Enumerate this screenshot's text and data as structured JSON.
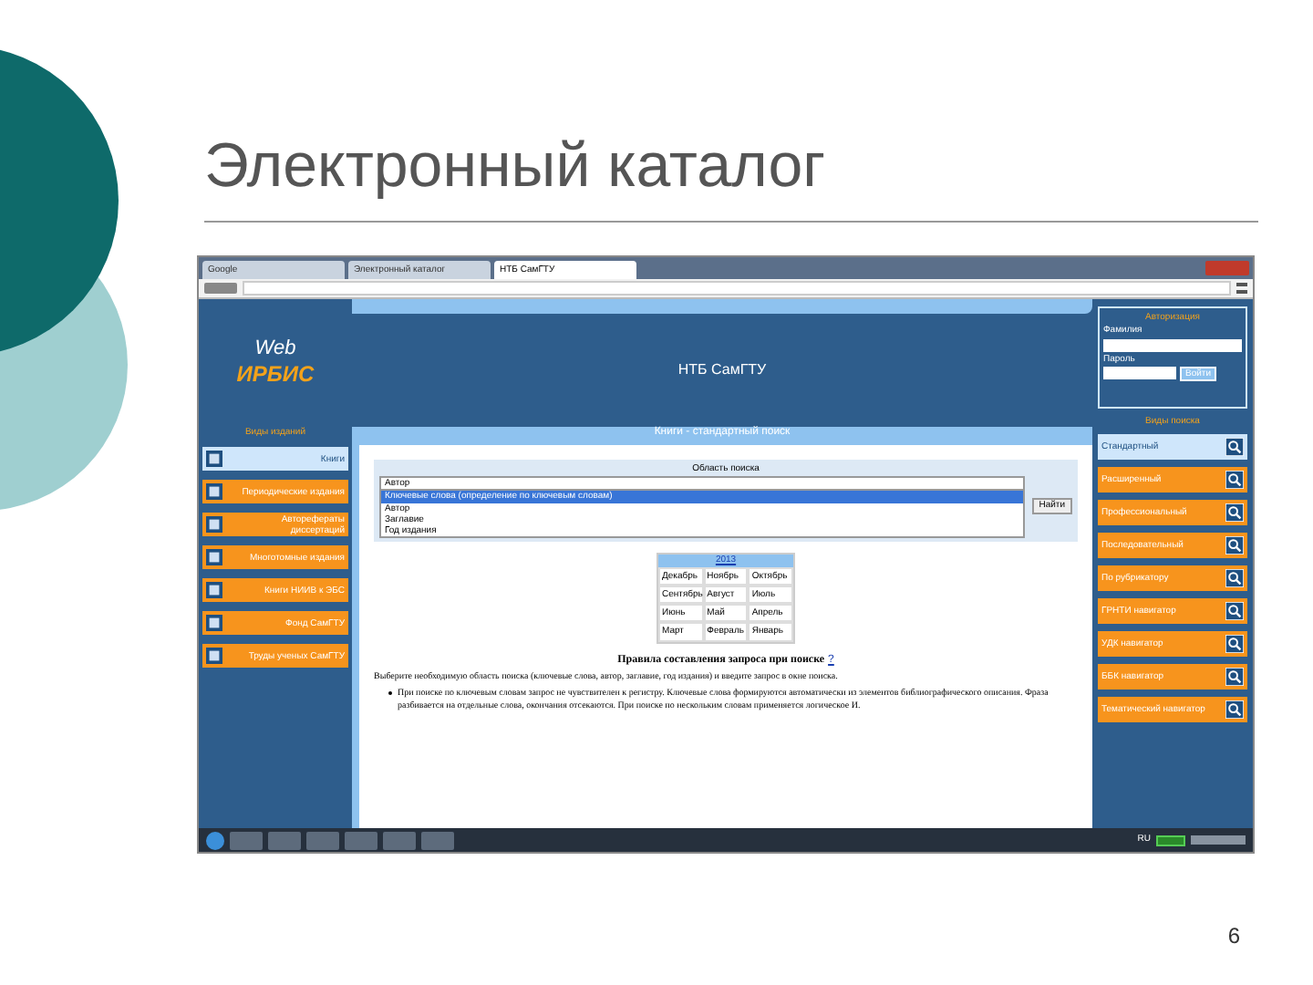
{
  "slide": {
    "title": "Электронный каталог",
    "page_number": "6"
  },
  "browser": {
    "tabs": [
      {
        "label": "Google",
        "selected": false
      },
      {
        "label": "Электронный каталог",
        "selected": false
      },
      {
        "label": "НТБ СамГТУ",
        "selected": true
      }
    ]
  },
  "site": {
    "logo_top": "Web",
    "logo_bottom": "ИРБИС",
    "header_title": "НТБ СамГТУ",
    "auth": {
      "title": "Авторизация",
      "surname_label": "Фамилия",
      "password_label": "Пароль",
      "login_button": "Войти"
    },
    "left_menu": {
      "title": "Виды изданий",
      "items": [
        {
          "label": "Книги",
          "selected": true
        },
        {
          "label": "Периодические издания",
          "selected": false
        },
        {
          "label": "Авторефераты диссертаций",
          "selected": false
        },
        {
          "label": "Многотомные издания",
          "selected": false
        },
        {
          "label": "Книги НИИВ к ЭБС",
          "selected": false
        },
        {
          "label": "Фонд СамГТУ",
          "selected": false
        },
        {
          "label": "Труды ученых СамГТУ",
          "selected": false
        }
      ]
    },
    "right_menu": {
      "title": "Виды поиска",
      "items": [
        {
          "label": "Стандартный",
          "selected": true
        },
        {
          "label": "Расширенный",
          "selected": false
        },
        {
          "label": "Профессиональный",
          "selected": false
        },
        {
          "label": "Последовательный",
          "selected": false
        },
        {
          "label": "По рубрикатору",
          "selected": false
        },
        {
          "label": "ГРНТИ навигатор",
          "selected": false
        },
        {
          "label": "УДК навигатор",
          "selected": false
        },
        {
          "label": "ББК навигатор",
          "selected": false
        },
        {
          "label": "Тематический навигатор",
          "selected": false
        }
      ]
    },
    "search": {
      "panel_title": "Книги - стандартный поиск",
      "field_label": "Область поиска",
      "select_value": "Автор",
      "options": [
        {
          "label": "Ключевые слова (определение по ключевым словам)",
          "selected": true
        },
        {
          "label": "Автор",
          "selected": false
        },
        {
          "label": "Заглавие",
          "selected": false
        },
        {
          "label": "Год издания",
          "selected": false
        }
      ],
      "find_button": "Найти"
    },
    "calendar": {
      "year": "2013",
      "months": [
        "Декабрь",
        "Ноябрь",
        "Октябрь",
        "Сентябрь",
        "Август",
        "Июль",
        "Июнь",
        "Май",
        "Апрель",
        "Март",
        "Февраль",
        "Январь"
      ]
    },
    "rules": {
      "title": "Правила составления запроса при поиске",
      "help_link": "?",
      "intro": "Выберите необходимую область поиска (ключевые слова, автор, заглавие, год издания) и введите запрос в окне поиска.",
      "bullet": "При поиске по ключевым словам запрос не чувствителен к регистру. Ключевые слова формируются автоматически из элементов библиографического описания. Фраза разбивается на отдельные слова, окончания отсекаются. При поиске по нескольким словам применяется логическое И."
    }
  },
  "taskbar": {
    "language": "RU"
  }
}
